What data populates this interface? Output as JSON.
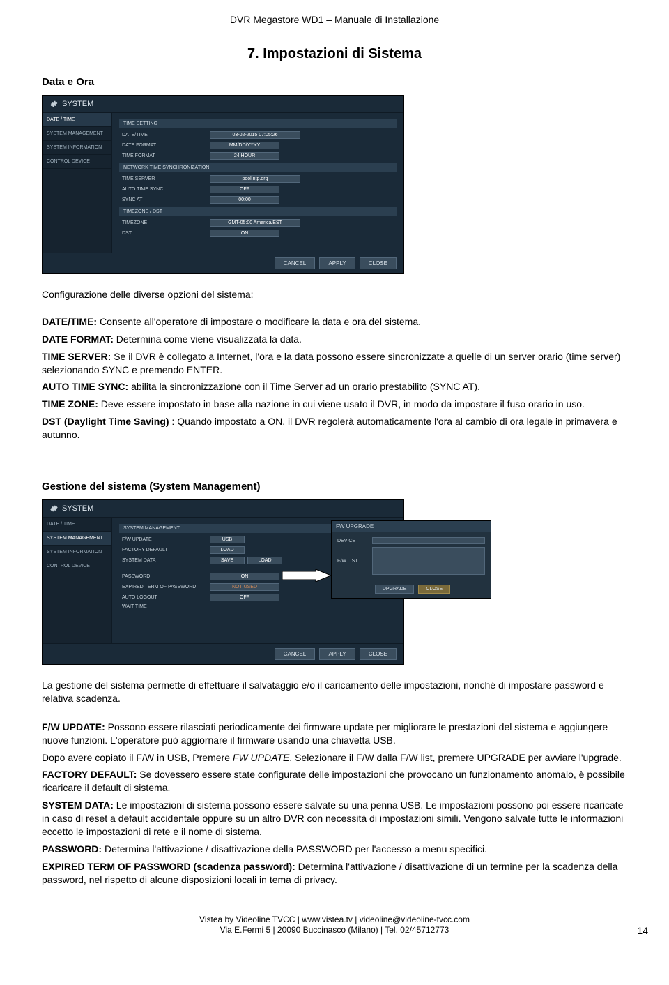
{
  "header": "DVR Megastore WD1 – Manuale di Installazione",
  "section_title": "7. Impostazioni di Sistema",
  "subsection1": "Data e Ora",
  "fig1": {
    "title": "SYSTEM",
    "sidebar": [
      "DATE / TIME",
      "SYSTEM MANAGEMENT",
      "SYSTEM INFORMATION",
      "CONTROL DEVICE"
    ],
    "sec1": "TIME SETTING",
    "rows1": [
      {
        "label": "DATE/TIME",
        "value": "03-02-2015 07:05:26"
      },
      {
        "label": "DATE FORMAT",
        "value": "MM/DD/YYYY"
      },
      {
        "label": "TIME FORMAT",
        "value": "24 HOUR"
      }
    ],
    "sec2": "NETWORK TIME SYNCHRONIZATION",
    "rows2": [
      {
        "label": "TIME SERVER",
        "value": "pool.ntp.org"
      },
      {
        "label": "AUTO TIME SYNC",
        "value": "OFF"
      },
      {
        "label": "SYNC AT",
        "value": "00:00"
      }
    ],
    "sec3": "TIMEZONE / DST",
    "rows3": [
      {
        "label": "TIMEZONE",
        "value": "GMT-05:00 America/EST"
      },
      {
        "label": "DST",
        "value": "ON"
      }
    ],
    "buttons": [
      "CANCEL",
      "APPLY",
      "CLOSE"
    ]
  },
  "body1": {
    "intro": "Configurazione delle diverse opzioni del sistema:",
    "p1_b": "DATE/TIME:",
    "p1": " Consente all'operatore di impostare o modificare la data e ora del sistema.",
    "p2_b": "DATE FORMAT:",
    "p2": " Determina come viene visualizzata la data.",
    "p3_b": "TIME SERVER:",
    "p3": " Se il DVR è collegato a Internet, l'ora e la data possono essere sincronizzate a quelle di un server orario (time server) selezionando SYNC e premendo ENTER.",
    "p4_b": "AUTO TIME SYNC:",
    "p4": " abilita la sincronizzazione con il Time Server ad un orario prestabilito (SYNC AT).",
    "p5_b": "TIME ZONE:",
    "p5": " Deve essere impostato in base alla nazione in cui viene usato il DVR, in modo da impostare il fuso orario in uso.",
    "p6_b": "DST (Daylight Time Saving)",
    "p6": " : Quando impostato a ON, il DVR regolerà automaticamente l'ora al cambio di ora legale in primavera e autunno."
  },
  "subsection2": "Gestione del sistema (System Management)",
  "fig2": {
    "title": "SYSTEM",
    "sidebar": [
      "DATE / TIME",
      "SYSTEM MANAGEMENT",
      "SYSTEM INFORMATION",
      "CONTROL DEVICE"
    ],
    "sec1": "SYSTEM MANAGEMENT",
    "rows1": [
      {
        "label": "F/W UPDATE",
        "value": "USB"
      },
      {
        "label": "FACTORY DEFAULT",
        "value": "LOAD"
      },
      {
        "label": "SYSTEM DATA",
        "value": "SAVE",
        "value2": "LOAD"
      }
    ],
    "rows2": [
      {
        "label": "PASSWORD",
        "value": "ON"
      },
      {
        "label": "EXPIRED TERM OF PASSWORD",
        "value": "NOT USED"
      },
      {
        "label": "AUTO LOGOUT",
        "value": "OFF"
      },
      {
        "label": "WAIT TIME",
        "value": ""
      }
    ],
    "buttons": [
      "CANCEL",
      "APPLY",
      "CLOSE"
    ],
    "popup": {
      "title": "FW UPGRADE",
      "rows": [
        {
          "label": "DEVICE",
          "value": ""
        },
        {
          "label": "F/W LIST",
          "value": ""
        }
      ],
      "upgrade": "UPGRADE",
      "close": "CLOSE"
    }
  },
  "body2": {
    "intro": "La gestione del sistema permette di effettuare il salvataggio e/o il caricamento delle impostazioni, nonché di impostare password e relativa scadenza.",
    "p1_b": "F/W UPDATE:",
    "p1": " Possono essere rilasciati periodicamente dei firmware update per migliorare le prestazioni del sistema e aggiungere nuove funzioni. L'operatore può aggiornare il firmware usando una chiavetta USB.",
    "p1_cont_a": "Dopo avere copiato il F/W in USB, Premere ",
    "p1_cont_i": "FW UPDATE",
    "p1_cont_b": ". Selezionare il F/W dalla  F/W list, premere UPGRADE per avviare l'upgrade.",
    "p2_b": "FACTORY DEFAULT:",
    "p2": " Se dovessero essere state configurate delle impostazioni che provocano un funzionamento anomalo, è possibile ricaricare il default di sistema.",
    "p3_b": "SYSTEM DATA:",
    "p3": " Le impostazioni di sistema possono essere salvate su una penna USB. Le impostazioni possono poi essere ricaricate in caso di reset a default accidentale oppure su un altro DVR con necessità di impostazioni simili. Vengono salvate tutte le informazioni eccetto le impostazioni di rete e il nome di sistema.",
    "p4_b": "PASSWORD:",
    "p4": " Determina l'attivazione / disattivazione della PASSWORD per l'accesso a menu specifici.",
    "p5_b": "EXPIRED TERM OF PASSWORD (scadenza password):",
    "p5": " Determina l'attivazione / disattivazione di un termine per la scadenza della password, nel rispetto di alcune disposizioni locali in tema di privacy."
  },
  "footer": {
    "line1": "Vistea by Videoline TVCC | www.vistea.tv | videoline@videoline-tvcc.com",
    "line2": "Via E.Fermi 5  | 20090 Buccinasco (Milano) | Tel. 02/45712773",
    "page": "14"
  }
}
